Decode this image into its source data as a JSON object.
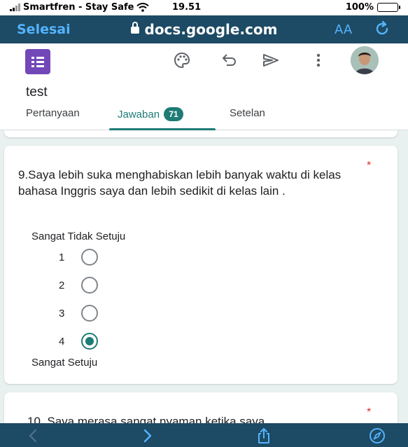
{
  "status_bar": {
    "carrier": "Smartfren - Stay Safe",
    "time": "19.51",
    "battery": "100%"
  },
  "browser": {
    "done_label": "Selesai",
    "url": "docs.google.com",
    "text_size_label": "AA",
    "accent_color": "#55b3ff",
    "bar_color": "#1d4a64"
  },
  "form": {
    "title": "test",
    "icons": [
      "forms-logo-icon",
      "palette-icon",
      "undo-icon",
      "send-icon",
      "more-vert-icon",
      "avatar"
    ],
    "tabs": [
      {
        "label": "Pertanyaan",
        "active": false
      },
      {
        "label": "Jawaban",
        "active": true,
        "badge": "71"
      },
      {
        "label": "Setelan",
        "active": false
      }
    ],
    "theme_color": "#1e7b75"
  },
  "question9": {
    "required_mark": "*",
    "text": "9.Saya lebih suka menghabiskan lebih banyak waktu di kelas bahasa Inggris saya dan lebih sedikit di kelas lain .",
    "low_label": "Sangat Tidak Setuju",
    "high_label": "Sangat Setuju",
    "options": [
      {
        "value": "1",
        "checked": false
      },
      {
        "value": "2",
        "checked": false
      },
      {
        "value": "3",
        "checked": false
      },
      {
        "value": "4",
        "checked": true
      }
    ]
  },
  "question10": {
    "required_mark": "*",
    "text": "10. Saya    merasa sangat nyaman ketika saya"
  },
  "bottom_bar": {
    "icons": [
      "back-icon",
      "forward-icon",
      "share-icon",
      "compass-icon"
    ]
  }
}
